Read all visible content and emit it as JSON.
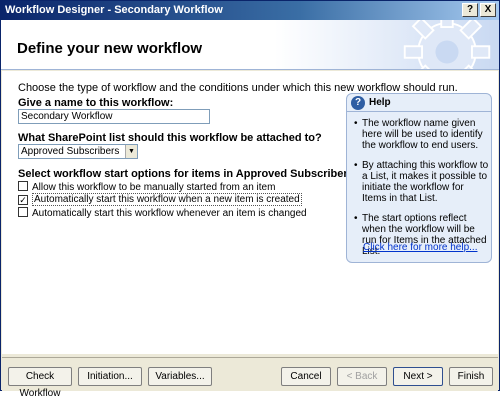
{
  "window": {
    "title": "Workflow Designer - Secondary Workflow",
    "help_btn": "?",
    "close_btn": "X"
  },
  "banner": {
    "title": "Define your new workflow"
  },
  "main": {
    "intro": "Choose the type of workflow and the conditions under which this new workflow should run.",
    "name_label": "Give a name to this workflow:",
    "name_value": "Secondary Workflow",
    "list_label": "What SharePoint list should this workflow be attached to?",
    "list_value": "Approved Subscribers",
    "options_label": "Select workflow start options for items in Approved Subscribers:",
    "options": [
      {
        "label": "Allow this workflow to be manually started from an item",
        "checked": false
      },
      {
        "label": "Automatically start this workflow when a new item is created",
        "checked": true
      },
      {
        "label": "Automatically start this workflow whenever an item is changed",
        "checked": false
      }
    ]
  },
  "help": {
    "title": "Help",
    "items": [
      "The workflow name given here will be used to identify the workflow to end users.",
      "By attaching this workflow to a List, it makes it possible to initiate the workflow for Items in that List.",
      "The start options reflect when the workflow will be run for Items in the attached List."
    ],
    "link": "Click here for more help..."
  },
  "footer": {
    "check": "Check Workflow",
    "initiation": "Initiation...",
    "variables": "Variables...",
    "cancel": "Cancel",
    "back": "< Back",
    "next": "Next >",
    "finish": "Finish"
  },
  "colors": {
    "titlebar": "#0a246a",
    "banner_accent": "#c9d9f2",
    "help_bg": "#e6eef9",
    "link": "#0033cc"
  }
}
